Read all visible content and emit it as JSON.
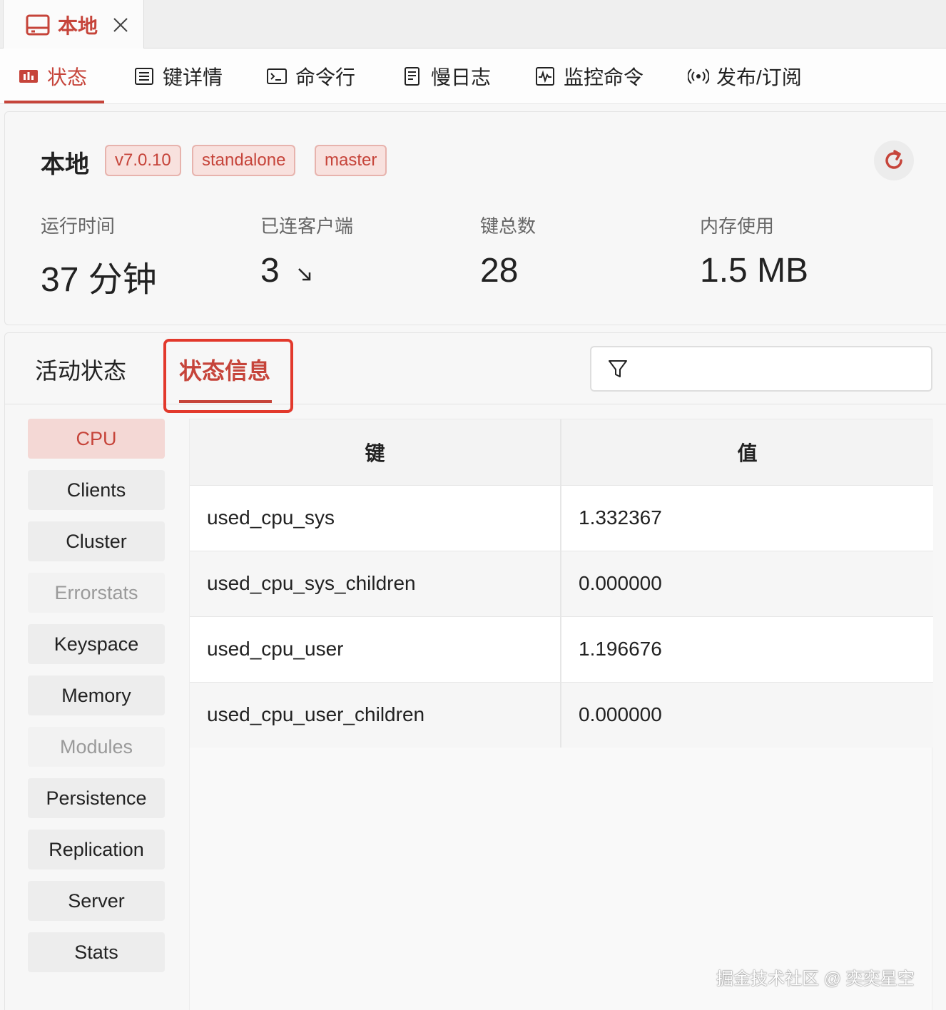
{
  "connection_tab": {
    "title": "本地",
    "icon": "server-icon"
  },
  "subnav": {
    "items": [
      {
        "label": "状态",
        "icon": "bar-chart-icon"
      },
      {
        "label": "键详情",
        "icon": "list-icon"
      },
      {
        "label": "命令行",
        "icon": "terminal-icon"
      },
      {
        "label": "慢日志",
        "icon": "log-icon"
      },
      {
        "label": "监控命令",
        "icon": "pulse-icon"
      },
      {
        "label": "发布/订阅",
        "icon": "broadcast-icon"
      }
    ],
    "active_index": 0
  },
  "info": {
    "server_name": "本地",
    "badges": [
      "v7.0.10",
      "standalone",
      "master"
    ],
    "stats": [
      {
        "label": "运行时间",
        "value": "37 分钟"
      },
      {
        "label": "已连客户端",
        "value": "3"
      },
      {
        "label": "键总数",
        "value": "28"
      },
      {
        "label": "内存使用",
        "value": "1.5 MB"
      }
    ]
  },
  "panel": {
    "tabs": [
      {
        "label": "活动状态"
      },
      {
        "label": "状态信息"
      }
    ],
    "active_tab": 1,
    "filter": {
      "value": "",
      "placeholder": ""
    }
  },
  "sections": [
    {
      "label": "CPU",
      "state": "active"
    },
    {
      "label": "Clients",
      "state": "normal"
    },
    {
      "label": "Cluster",
      "state": "normal"
    },
    {
      "label": "Errorstats",
      "state": "disabled"
    },
    {
      "label": "Keyspace",
      "state": "normal"
    },
    {
      "label": "Memory",
      "state": "normal"
    },
    {
      "label": "Modules",
      "state": "disabled"
    },
    {
      "label": "Persistence",
      "state": "normal"
    },
    {
      "label": "Replication",
      "state": "normal"
    },
    {
      "label": "Server",
      "state": "normal"
    },
    {
      "label": "Stats",
      "state": "normal"
    }
  ],
  "table": {
    "headers": {
      "key": "键",
      "value": "值"
    },
    "rows": [
      {
        "key": "used_cpu_sys",
        "value": "1.332367"
      },
      {
        "key": "used_cpu_sys_children",
        "value": "0.000000"
      },
      {
        "key": "used_cpu_user",
        "value": "1.196676"
      },
      {
        "key": "used_cpu_user_children",
        "value": "0.000000"
      }
    ]
  },
  "watermark": "掘金技术社区 @ 奕奕星空",
  "colors": {
    "accent": "#c6443a",
    "highlight": "#e2392c",
    "badge_bg": "#f8e1de"
  }
}
